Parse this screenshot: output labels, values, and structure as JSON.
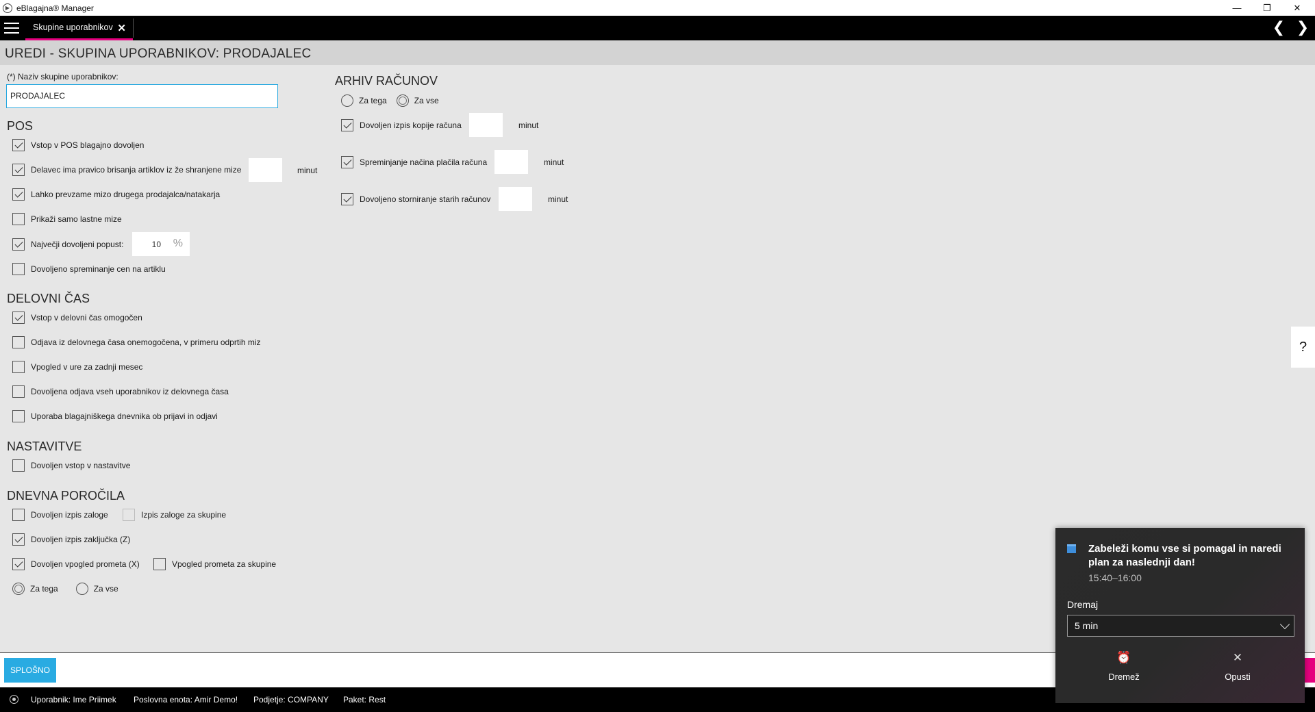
{
  "window": {
    "title": "eBlagajna® Manager",
    "minimize": "—",
    "restore": "❐",
    "close": "✕"
  },
  "tabbar": {
    "tab_label": "Skupine uporabnikov",
    "tab_close": "✕",
    "prev": "❮",
    "next": "❯"
  },
  "page": {
    "heading": "UREDI - SKUPINA UPORABNIKOV: PRODAJALEC"
  },
  "group_name": {
    "label": "(*) Naziv skupine uporabnikov:",
    "value": "PRODAJALEC"
  },
  "pos": {
    "title": "POS",
    "items": [
      {
        "label": "Vstop v POS blagajno dovoljen",
        "checked": true
      },
      {
        "label": "Delavec ima pravico brisanja artiklov iz že shranjene mize",
        "checked": true
      },
      {
        "label": "Lahko prevzame mizo drugega prodajalca/natakarja",
        "checked": true
      },
      {
        "label": "Prikaži samo lastne mize",
        "checked": false
      },
      {
        "label": "Največji dovoljeni popust:",
        "checked": true
      },
      {
        "label": "Dovoljeno spreminanje cen na artiklu",
        "checked": false
      }
    ],
    "delete_unit": "minut",
    "discount_value": "10",
    "discount_unit": "%"
  },
  "delovni_cas": {
    "title": "DELOVNI ČAS",
    "items": [
      {
        "label": "Vstop v delovni čas omogočen",
        "checked": true
      },
      {
        "label": "Odjava iz delovnega časa onemogočena, v primeru odprtih miz",
        "checked": false
      },
      {
        "label": "Vpogled v ure za zadnji mesec",
        "checked": false
      },
      {
        "label": "Dovoljena odjava vseh uporabnikov iz delovnega časa",
        "checked": false
      },
      {
        "label": "Uporaba blagajniškega dnevnika ob prijavi in odjavi",
        "checked": false
      }
    ]
  },
  "nastavitve": {
    "title": "NASTAVITVE",
    "items": [
      {
        "label": "Dovoljen vstop v nastavitve",
        "checked": false
      }
    ]
  },
  "dnevna_porocila": {
    "title": "DNEVNA POROČILA",
    "zaloga": {
      "label": "Dovoljen izpis zaloge",
      "checked": false
    },
    "zaloga_skupine": {
      "label": "Izpis zaloge za skupine",
      "checked": false
    },
    "zakljucek": {
      "label": "Dovoljen izpis zaključka (Z)",
      "checked": true
    },
    "promet": {
      "label": "Dovoljen vpogled prometa (X)",
      "checked": true
    },
    "promet_skupine": {
      "label": "Vpogled prometa za skupine",
      "checked": false
    },
    "radio_tega": "Za tega",
    "radio_vse": "Za vse",
    "selected": "tega"
  },
  "arhiv": {
    "title": "ARHIV RAČUNOV",
    "radio_tega": "Za tega",
    "radio_vse": "Za vse",
    "selected": "vse",
    "items": [
      {
        "label": "Dovoljen izpis kopije računa",
        "checked": true,
        "unit": "minut"
      },
      {
        "label": "Spreminjanje načina plačila računa",
        "checked": true,
        "unit": "minut"
      },
      {
        "label": "Dovoljeno storniranje starih računov",
        "checked": true,
        "unit": "minut"
      }
    ]
  },
  "help": {
    "label": "?"
  },
  "bottom": {
    "button": "SPLOŠNO"
  },
  "status": {
    "user": "Uporabnik: Ime Priimek",
    "unit": "Poslovna enota: Amir Demo!",
    "company": "Podjetje: COMPANY",
    "package": "Paket: Rest"
  },
  "toast": {
    "title": "Zabeleži komu vse si pomagal in naredi plan za naslednji dan!",
    "time": "15:40–16:00",
    "snooze_label": "Dremaj",
    "snooze_value": "5 min",
    "btn_snooze": "Dremež",
    "btn_dismiss": "Opusti",
    "snooze_icon": "⏰",
    "dismiss_icon": "✕"
  }
}
